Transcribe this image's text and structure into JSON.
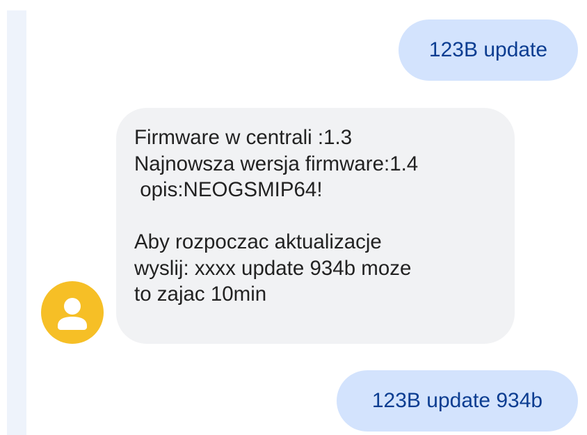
{
  "conversation": {
    "messages": [
      {
        "direction": "outgoing",
        "text": "123B update"
      },
      {
        "direction": "incoming",
        "text": "Firmware w centrali :1.3\nNajnowsza wersja firmware:1.4\n opis:NEOGSMIP64!\n\nAby rozpoczac aktualizacje\nwyslij: xxxx update 934b moze\nto zajac 10min"
      },
      {
        "direction": "outgoing",
        "text": "123B update 934b"
      }
    ],
    "contact_avatar": {
      "icon": "person-icon",
      "color": "#f6bf26"
    }
  },
  "colors": {
    "outgoing_bubble": "#d3e3fd",
    "outgoing_text": "#0b3d91",
    "incoming_bubble": "#f1f2f4"
  }
}
